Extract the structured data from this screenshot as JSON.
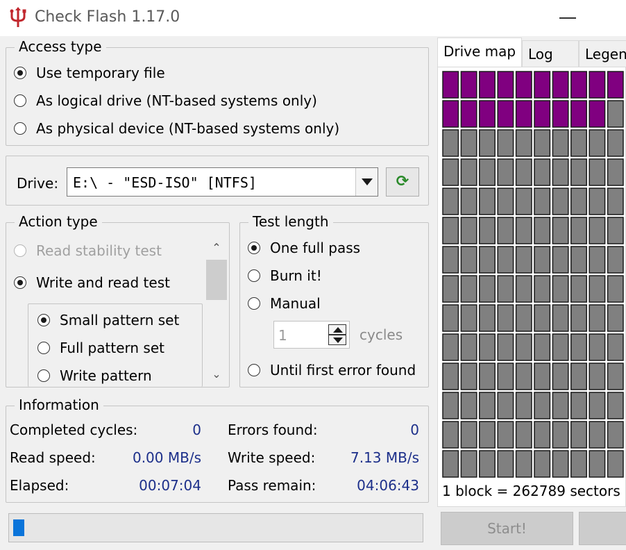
{
  "window": {
    "title": "Check Flash 1.17.0",
    "app_icon": "usb-trident-icon"
  },
  "access_type": {
    "legend": "Access type",
    "options": [
      {
        "label": "Use temporary file",
        "checked": true
      },
      {
        "label": "As logical drive (NT-based systems only)",
        "checked": false
      },
      {
        "label": "As physical device (NT-based systems only)",
        "checked": false
      }
    ]
  },
  "drive": {
    "label": "Drive:",
    "value": "E:\\ - \"ESD-ISO\" [NTFS]",
    "refresh_icon": "refresh-icon"
  },
  "action_type": {
    "legend": "Action type",
    "options": [
      {
        "label": "Read stability test",
        "checked": false,
        "disabled": true
      },
      {
        "label": "Write and read test",
        "checked": true,
        "disabled": false
      }
    ],
    "sub_options": [
      {
        "label": "Small pattern set",
        "checked": true
      },
      {
        "label": "Full pattern set",
        "checked": false
      },
      {
        "label": "Write pattern",
        "checked": false
      }
    ],
    "scroll_up_glyph": "⌃",
    "scroll_down_glyph": "⌄"
  },
  "test_length": {
    "legend": "Test length",
    "options": [
      {
        "label": "One full pass",
        "checked": true
      },
      {
        "label": "Burn it!",
        "checked": false
      },
      {
        "label": "Manual",
        "checked": false
      },
      {
        "label": "Until first error found",
        "checked": false
      }
    ],
    "cycles_value": "1",
    "cycles_label": "cycles"
  },
  "information": {
    "legend": "Information",
    "completed_cycles_label": "Completed cycles:",
    "completed_cycles": "0",
    "errors_found_label": "Errors found:",
    "errors_found": "0",
    "read_speed_label": "Read speed:",
    "read_speed": "0.00 MB/s",
    "write_speed_label": "Write speed:",
    "write_speed": "7.13 MB/s",
    "elapsed_label": "Elapsed:",
    "elapsed": "00:07:04",
    "pass_remain_label": "Pass remain:",
    "pass_remain": "04:06:43"
  },
  "progress": {
    "fraction": 0.028
  },
  "tabs": [
    {
      "label": "Drive map",
      "active": true
    },
    {
      "label": "Log",
      "active": false
    },
    {
      "label": "Legend",
      "active": false
    }
  ],
  "drive_map": {
    "columns": 10,
    "rows": 14,
    "written_blocks": 19,
    "written_color": "#800080",
    "unused_color": "#808080",
    "caption": "1 block = 262789 sectors"
  },
  "start_button": {
    "label": "Start!"
  }
}
